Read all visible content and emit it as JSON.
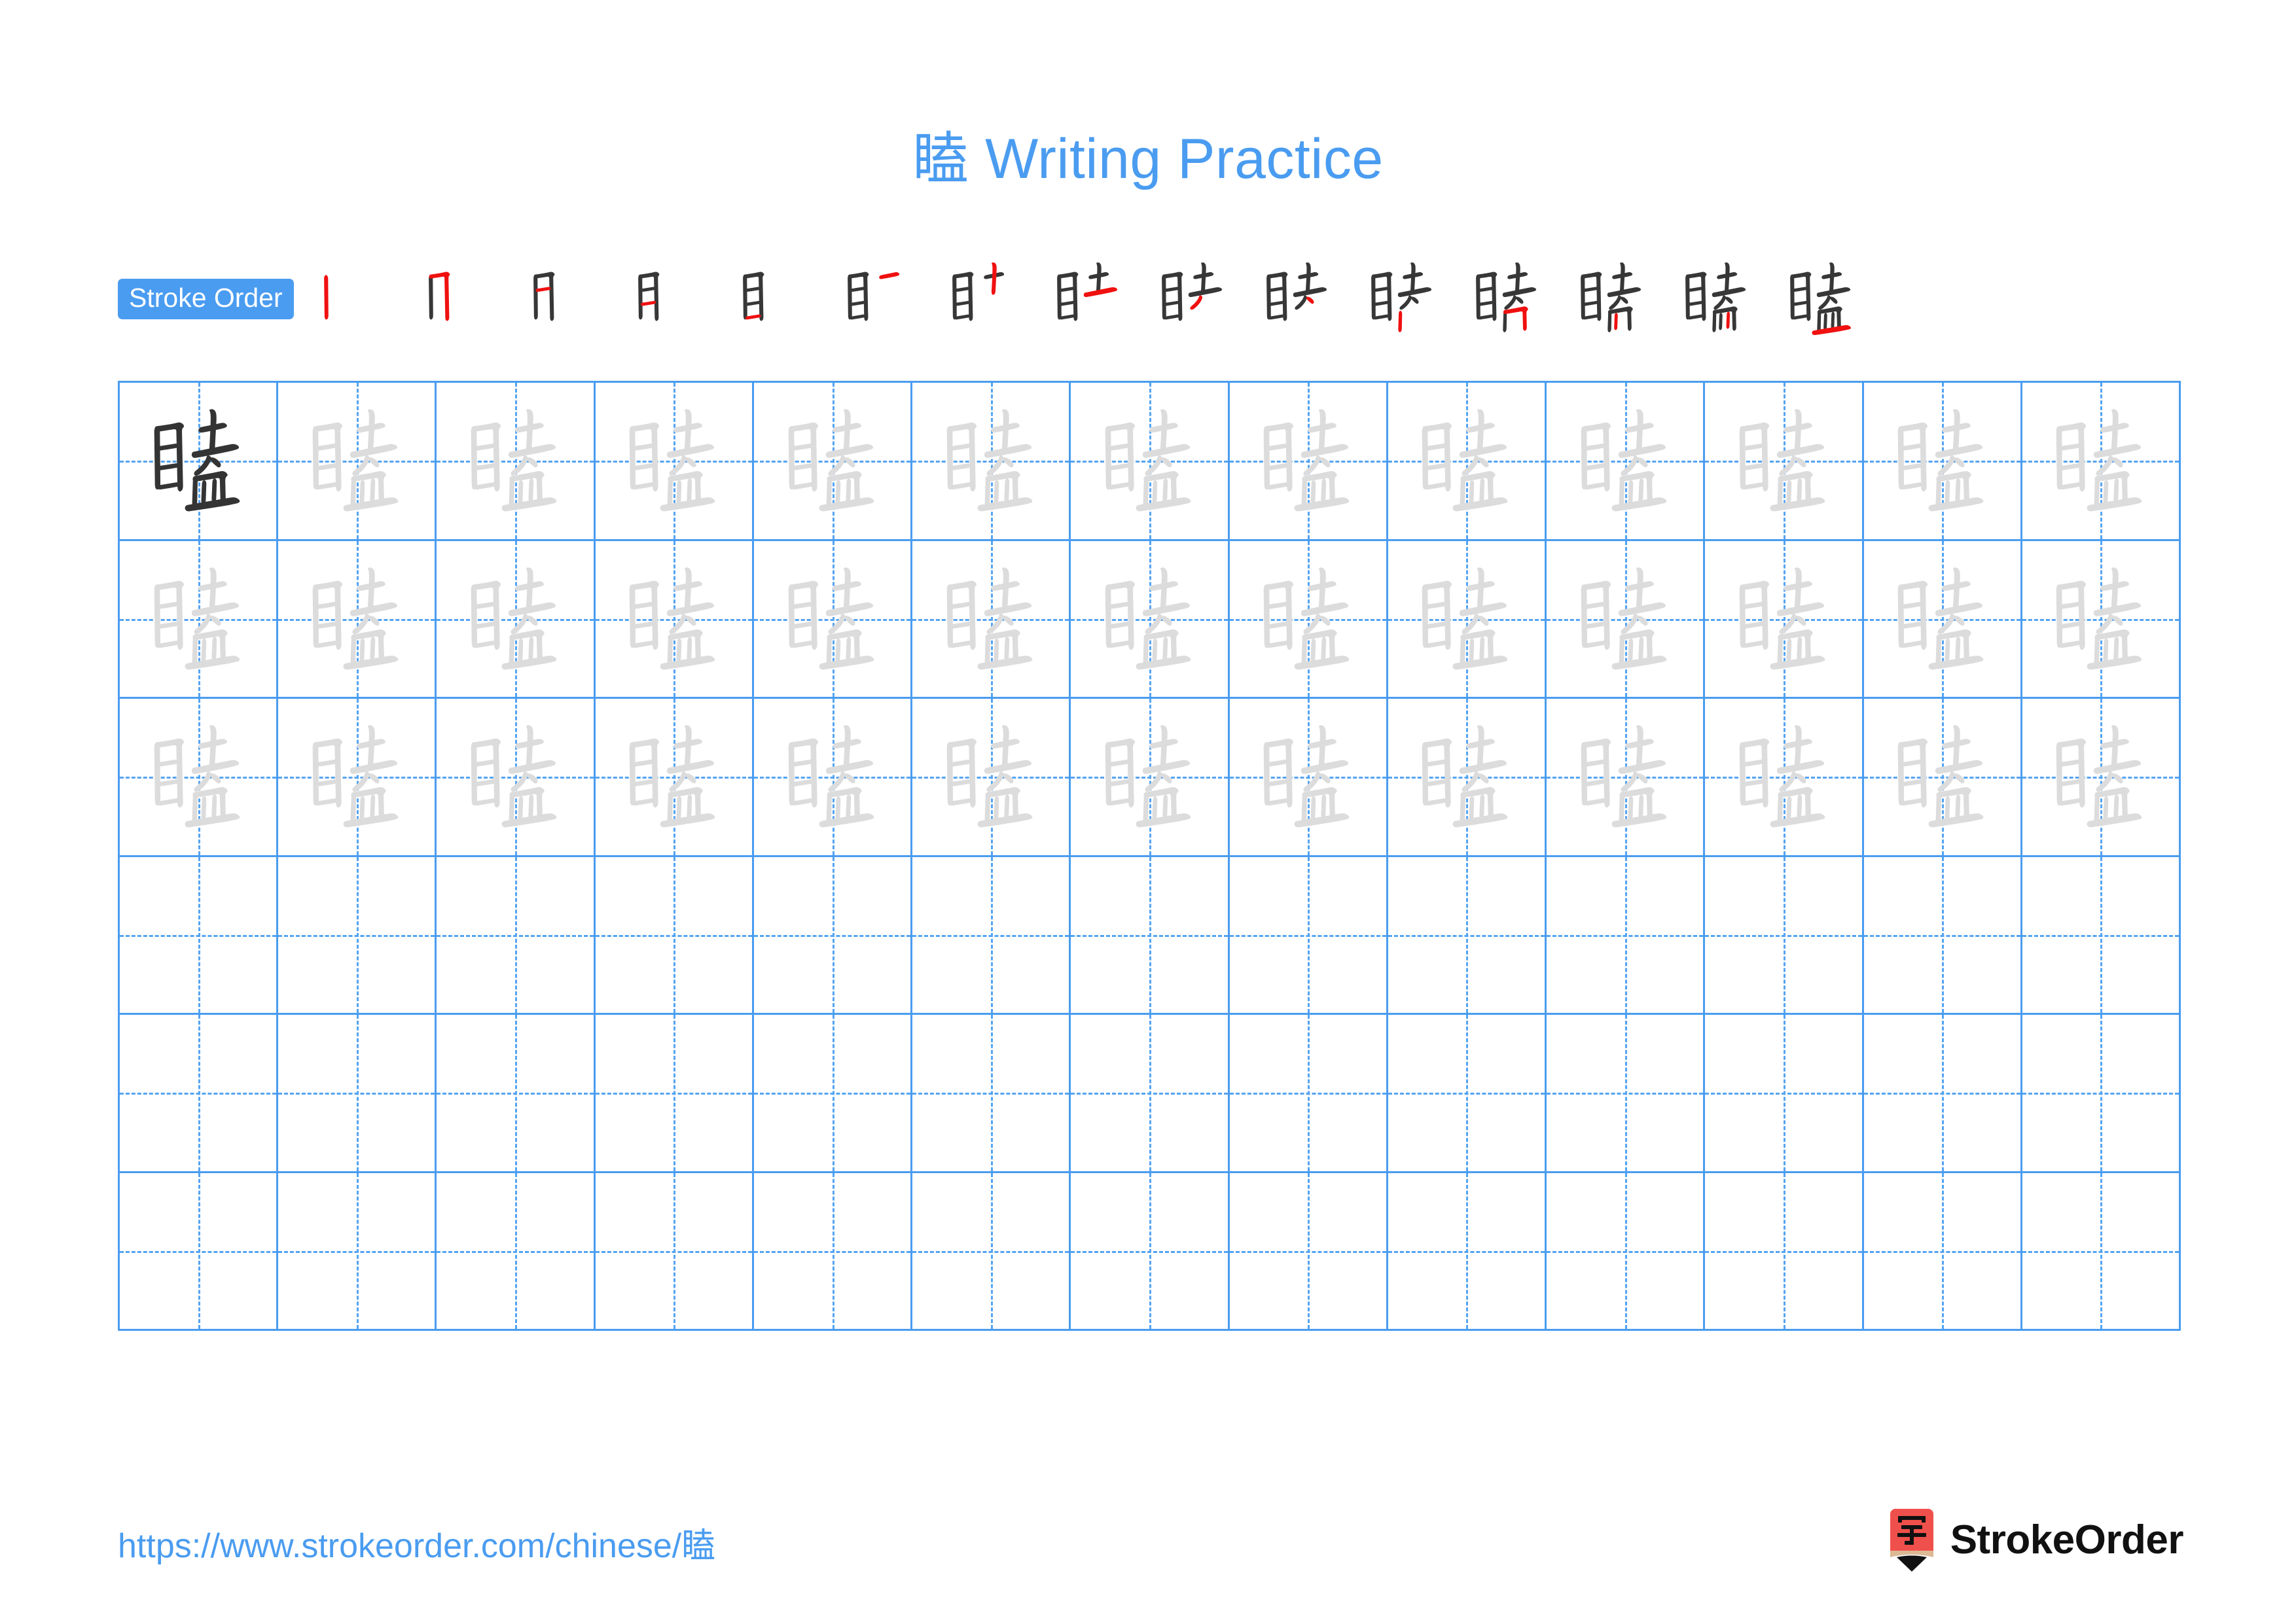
{
  "character": "瞌",
  "title": {
    "character": "瞌",
    "suffix": " Writing Practice",
    "full": "瞌 Writing Practice",
    "color": "#4a9cf0"
  },
  "stroke_order": {
    "badge_label": "Stroke Order",
    "badge_bg": "#4a9cf0",
    "badge_text_color": "#ffffff",
    "total_strokes": 15,
    "completed_stroke_color": "#373737",
    "new_stroke_color": "#f01010",
    "steps": [
      {
        "index": 1,
        "name": "stroke-step-1",
        "strokes_shown": 1,
        "new_stroke": "vertical-left-of-eye-radical"
      },
      {
        "index": 2,
        "name": "stroke-step-2",
        "strokes_shown": 2,
        "new_stroke": "horizontal-turning-vertical-hook"
      },
      {
        "index": 3,
        "name": "stroke-step-3",
        "strokes_shown": 3,
        "new_stroke": "inner-horizontal-upper"
      },
      {
        "index": 4,
        "name": "stroke-step-4",
        "strokes_shown": 4,
        "new_stroke": "inner-horizontal-lower"
      },
      {
        "index": 5,
        "name": "stroke-step-5",
        "strokes_shown": 5,
        "new_stroke": "bottom-horizontal-of-eye"
      },
      {
        "index": 6,
        "name": "stroke-step-6",
        "strokes_shown": 6,
        "new_stroke": "top-horizontal-of-tu"
      },
      {
        "index": 7,
        "name": "stroke-step-7",
        "strokes_shown": 7,
        "new_stroke": "vertical-of-tu"
      },
      {
        "index": 8,
        "name": "stroke-step-8",
        "strokes_shown": 8,
        "new_stroke": "second-horizontal-of-tu"
      },
      {
        "index": 9,
        "name": "stroke-step-9",
        "strokes_shown": 9,
        "new_stroke": "left-falling-of-qu"
      },
      {
        "index": 10,
        "name": "stroke-step-10",
        "strokes_shown": 10,
        "new_stroke": "rising-dot-of-qu"
      },
      {
        "index": 11,
        "name": "stroke-step-11",
        "strokes_shown": 11,
        "new_stroke": "left-vertical-of-min"
      },
      {
        "index": 12,
        "name": "stroke-step-12",
        "strokes_shown": 12,
        "new_stroke": "horizontal-turn-vertical-of-min"
      },
      {
        "index": 13,
        "name": "stroke-step-13",
        "strokes_shown": 13,
        "new_stroke": "inner-vertical-left-of-min"
      },
      {
        "index": 14,
        "name": "stroke-step-14",
        "strokes_shown": 14,
        "new_stroke": "inner-vertical-right-of-min"
      },
      {
        "index": 15,
        "name": "stroke-step-15",
        "strokes_shown": 15,
        "new_stroke": "bottom-horizontal-of-min"
      }
    ]
  },
  "practice_grid": {
    "columns": 13,
    "rows": 6,
    "grid_line_color": "#4a9cf0",
    "guide_line_color": "#55a4f2",
    "dark_char_color": "#343434",
    "trace_char_color": "#dcdcdc",
    "cells": [
      [
        "dark",
        "trace",
        "trace",
        "trace",
        "trace",
        "trace",
        "trace",
        "trace",
        "trace",
        "trace",
        "trace",
        "trace",
        "trace"
      ],
      [
        "trace",
        "trace",
        "trace",
        "trace",
        "trace",
        "trace",
        "trace",
        "trace",
        "trace",
        "trace",
        "trace",
        "trace",
        "trace"
      ],
      [
        "trace",
        "trace",
        "trace",
        "trace",
        "trace",
        "trace",
        "trace",
        "trace",
        "trace",
        "trace",
        "trace",
        "trace",
        "trace"
      ],
      [
        "empty",
        "empty",
        "empty",
        "empty",
        "empty",
        "empty",
        "empty",
        "empty",
        "empty",
        "empty",
        "empty",
        "empty",
        "empty"
      ],
      [
        "empty",
        "empty",
        "empty",
        "empty",
        "empty",
        "empty",
        "empty",
        "empty",
        "empty",
        "empty",
        "empty",
        "empty",
        "empty"
      ],
      [
        "empty",
        "empty",
        "empty",
        "empty",
        "empty",
        "empty",
        "empty",
        "empty",
        "empty",
        "empty",
        "empty",
        "empty",
        "empty"
      ]
    ]
  },
  "footer": {
    "url_prefix": "https://www.strokeorder.com/chinese/",
    "url_character": "瞌",
    "url_full": "https://www.strokeorder.com/chinese/瞌",
    "url_color": "#4a9cf0",
    "brand_name": "StrokeOrder",
    "logo_character": "字",
    "logo_body_color": "#f0504b",
    "logo_tip_color": "#dcb894",
    "logo_point_color": "#111111"
  }
}
